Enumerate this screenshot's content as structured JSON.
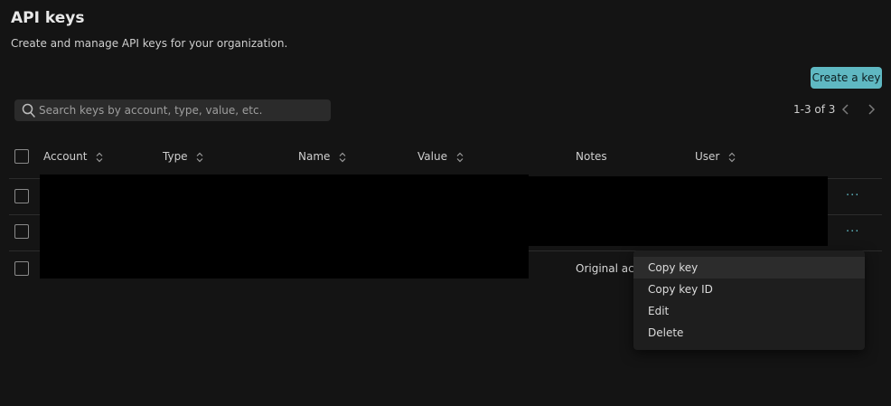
{
  "header": {
    "title": "API keys",
    "subtitle": "Create and manage API keys for your organization."
  },
  "toolbar": {
    "create_label": "Create a key"
  },
  "search": {
    "placeholder": "Search keys by account, type, value, etc."
  },
  "pagination": {
    "range_label": "1-3 of 3"
  },
  "table": {
    "columns": [
      {
        "label": "Account",
        "sortable": true
      },
      {
        "label": "Type",
        "sortable": true
      },
      {
        "label": "Name",
        "sortable": true
      },
      {
        "label": "Value",
        "sortable": true
      },
      {
        "label": "Notes",
        "sortable": false
      },
      {
        "label": "User",
        "sortable": true
      }
    ],
    "rows": [
      {
        "notes": "",
        "redacted": true
      },
      {
        "notes": "",
        "redacted": true
      },
      {
        "notes": "Original acc",
        "redacted": true
      }
    ]
  },
  "context_menu": {
    "items": [
      {
        "label": "Copy key"
      },
      {
        "label": "Copy key ID"
      },
      {
        "label": "Edit"
      },
      {
        "label": "Delete"
      }
    ]
  },
  "colors": {
    "accent": "#5fb8c2",
    "background": "#141414",
    "menu_background": "#1e1e1e"
  }
}
